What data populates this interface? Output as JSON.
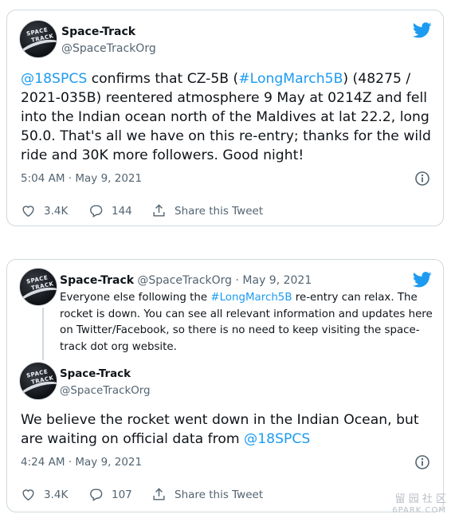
{
  "tweet1": {
    "name": "Space-Track",
    "handle": "@SpaceTrackOrg",
    "text_mention": "@18SPCS",
    "text_a": " confirms that CZ-5B (",
    "text_hashtag": "#LongMarch5B",
    "text_b": ") (48275 / 2021-035B) reentered atmosphere 9 May at 0214Z and fell into the Indian ocean north of the Maldives at lat 22.2, long 50.0.  That's all we have on this re-entry; thanks for the wild ride and 30K more followers.  Good night!",
    "timestamp": "5:04 AM · May 9, 2021",
    "likes": "3.4K",
    "replies": "144",
    "share_label": "Share this Tweet"
  },
  "tweet2": {
    "quoted": {
      "name": "Space-Track",
      "handle_date": "@SpaceTrackOrg · May 9, 2021",
      "text_a": "Everyone else following the ",
      "text_hashtag": "#LongMarch5B",
      "text_b": " re-entry can relax.  The rocket is down.  You can see all relevant information and updates here on Twitter/Facebook, so there is no need to keep visiting the space-track dot org website."
    },
    "name": "Space-Track",
    "handle": "@SpaceTrackOrg",
    "text_a": "We believe the rocket went down in the Indian Ocean, but are waiting on official data from ",
    "text_mention": "@18SPCS",
    "timestamp": "4:24 AM · May 9, 2021",
    "likes": "3.4K",
    "replies": "107",
    "share_label": "Share this Tweet"
  },
  "avatar_text": [
    "SPACE",
    "TRACK"
  ],
  "watermark": {
    "line1": "留 园 社 区",
    "line2": "6PARK.COM"
  },
  "colors": {
    "link": "#1d9bf0",
    "text": "#0f1419",
    "secondary": "#536471",
    "border": "#cfd9de"
  },
  "icons": [
    "twitter-bird-icon",
    "info-icon",
    "heart-icon",
    "reply-icon",
    "share-icon"
  ]
}
